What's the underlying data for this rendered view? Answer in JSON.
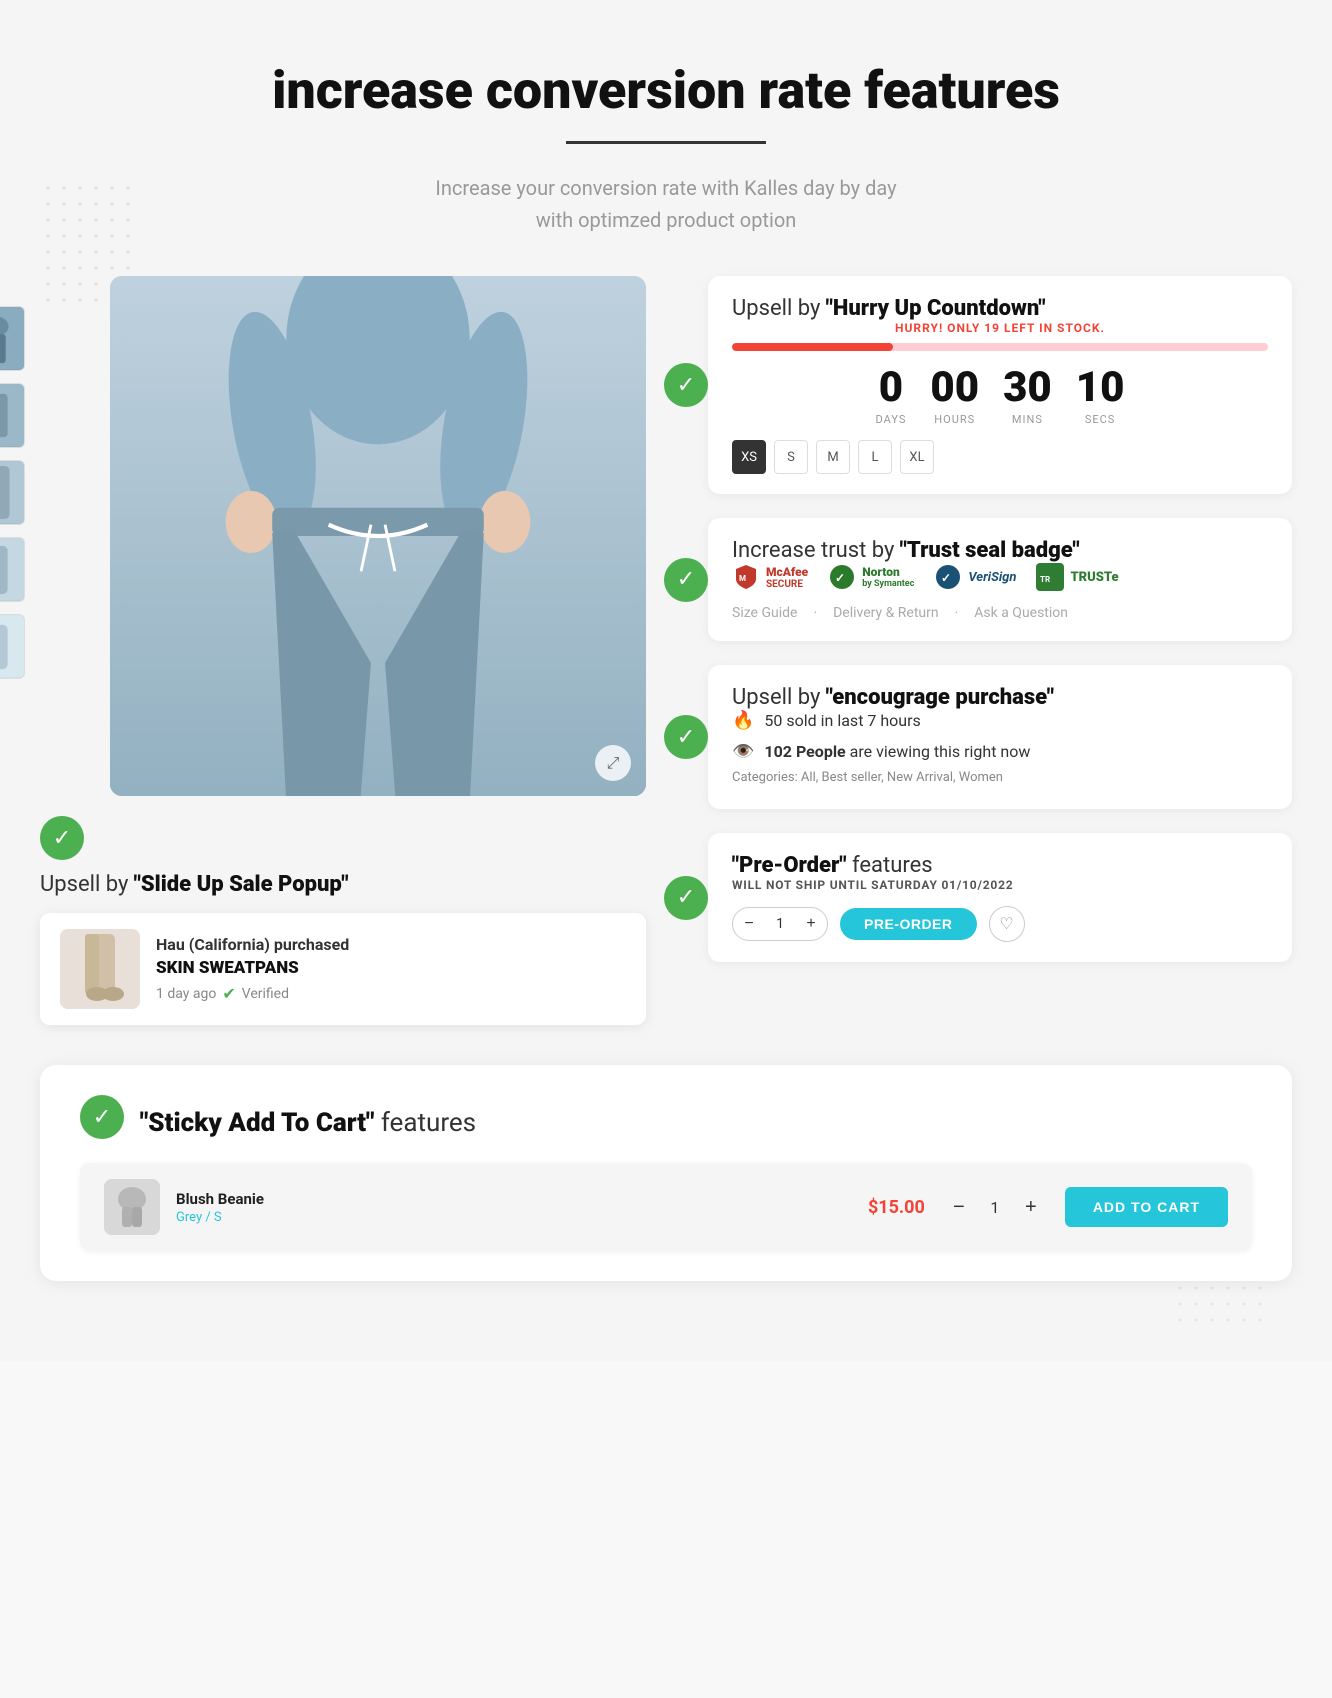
{
  "page": {
    "title": "increase conversion rate features",
    "subtitle": "Increase your conversion rate with Kalles  day by day\nwith optimzed product option"
  },
  "header": {
    "divider_color": "#333"
  },
  "countdown_feature": {
    "title_prefix": "Upsell by ",
    "title_bold": "\"Hurry Up Countdown\"",
    "hurry_text": "HURRY! ONLY ",
    "hurry_num": "19",
    "hurry_suffix": " LEFT IN STOCK.",
    "days": "0",
    "hours": "00",
    "mins": "30",
    "secs": "10",
    "days_label": "DAYS",
    "hours_label": "HOURS",
    "mins_label": "MINS",
    "secs_label": "SECS",
    "sizes": [
      "XS",
      "S",
      "M",
      "L",
      "XL"
    ],
    "active_size": "XS"
  },
  "trust_feature": {
    "title_prefix": "Increase trust by ",
    "title_bold": "\"Trust seal badge\"",
    "badges": [
      {
        "name": "McAfee SECURE",
        "icon": "🛡️",
        "class": "mcafee"
      },
      {
        "name": "Norton",
        "icon": "✔",
        "class": "norton"
      },
      {
        "name": "VeriSign",
        "icon": "✔",
        "class": "verisign"
      },
      {
        "name": "TRUSTe",
        "icon": "✔",
        "class": "truste"
      }
    ],
    "footer_links": [
      "Size Guide",
      "Delivery & Return",
      "Ask a Question"
    ]
  },
  "encourage_feature": {
    "title_prefix": "Upsell by ",
    "title_bold": "\"encougrage purchase\"",
    "items": [
      {
        "icon": "🔥",
        "text": "50 sold in last 7 hours"
      },
      {
        "icon": "👁️",
        "text_prefix": "102 ",
        "text_bold": "People",
        "text_suffix": " are viewing this right now"
      }
    ],
    "categories_label": "Categories: All, Best seller, New Arrival, Women"
  },
  "preorder_feature": {
    "title_prefix": "",
    "title_bold": "\"Pre-Order\"",
    "title_suffix": " features",
    "ship_text": "WILL NOT SHIP UNTIL SATURDAY 01/10/2022",
    "qty": "1",
    "btn_label": "PRE-ORDER"
  },
  "slideup_feature": {
    "title_prefix": "Upsell by ",
    "title_bold": "\"Slide Up Sale Popup\"",
    "buyer_name": "Hau (California)",
    "buyer_suffix": " purchased",
    "product_name": "SKIN SWEATPANS",
    "time": "1 day ago",
    "verified_label": "Verified"
  },
  "sticky_feature": {
    "title_bold": "\"Sticky Add To Cart\"",
    "title_suffix": " features",
    "product_name": "Blush Beanie",
    "variant": "Grey / S",
    "price": "$15.00",
    "qty": "1",
    "add_to_cart_label": "ADD TO CART"
  },
  "icons": {
    "check": "✓",
    "fire": "🔥",
    "eye": "👁️",
    "expand": "⤢",
    "heart": "♡",
    "minus": "−",
    "plus": "+"
  }
}
